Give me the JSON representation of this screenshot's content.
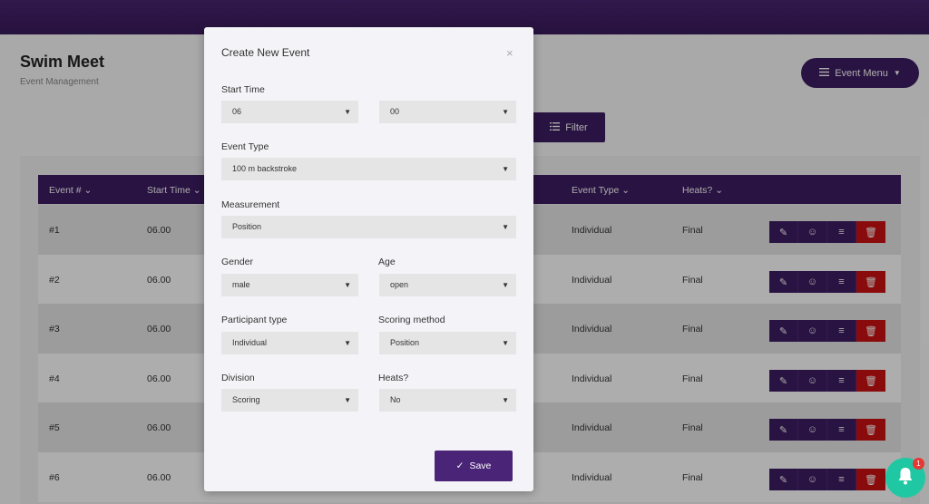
{
  "page": {
    "title": "Swim Meet",
    "subtitle": "Event Management",
    "event_menu_label": "Event Menu",
    "filter_label": "Filter"
  },
  "table": {
    "headers": [
      "Event #",
      "Start Time",
      "Event Type",
      "Heats?"
    ],
    "rows": [
      {
        "num": "#1",
        "time": "06.00",
        "type": "Individual",
        "heats": "Final"
      },
      {
        "num": "#2",
        "time": "06.00",
        "type": "Individual",
        "heats": "Final"
      },
      {
        "num": "#3",
        "time": "06.00",
        "type": "Individual",
        "heats": "Final"
      },
      {
        "num": "#4",
        "time": "06.00",
        "type": "Individual",
        "heats": "Final"
      },
      {
        "num": "#5",
        "time": "06.00",
        "type": "Individual",
        "heats": "Final"
      },
      {
        "num": "#6",
        "time": "06.00",
        "type": "Individual",
        "heats": "Final"
      }
    ]
  },
  "modal": {
    "title": "Create New Event",
    "close_label": "×",
    "save_label": "Save",
    "fields": {
      "start_time": {
        "label": "Start Time",
        "hour": "06",
        "minute": "00"
      },
      "event_type": {
        "label": "Event Type",
        "value": "100 m backstroke"
      },
      "measurement": {
        "label": "Measurement",
        "value": "Position"
      },
      "gender": {
        "label": "Gender",
        "value": "male"
      },
      "age": {
        "label": "Age",
        "value": "open"
      },
      "participant_type": {
        "label": "Participant type",
        "value": "Individual"
      },
      "scoring_method": {
        "label": "Scoring method",
        "value": "Position"
      },
      "division": {
        "label": "Division",
        "value": "Scoring"
      },
      "heats": {
        "label": "Heats?",
        "value": "No"
      }
    }
  },
  "notifications": {
    "count": "1"
  },
  "colors": {
    "brand": "#3d1c62",
    "danger": "#cc1111",
    "accent": "#1fc8a2"
  }
}
